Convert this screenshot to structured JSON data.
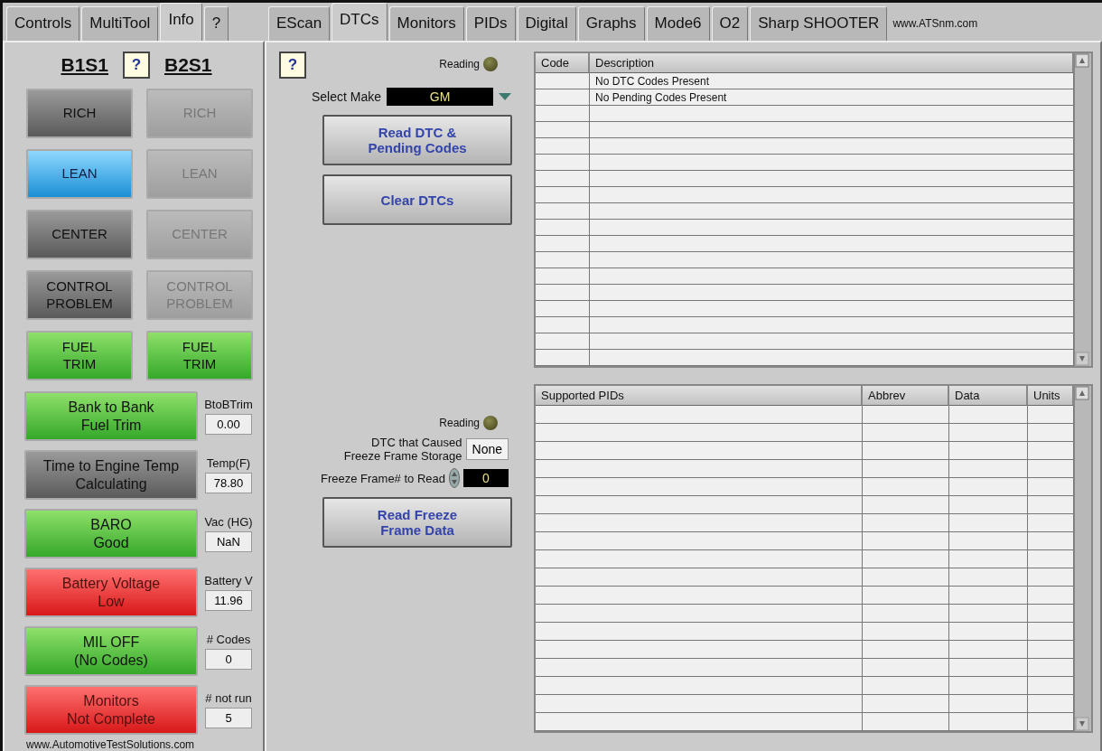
{
  "left_tabs": [
    {
      "label": "Controls",
      "selected": false
    },
    {
      "label": "MultiTool",
      "selected": false
    },
    {
      "label": "Info",
      "selected": true
    },
    {
      "label": "?",
      "selected": false
    }
  ],
  "right_tabs": [
    {
      "label": "EScan",
      "selected": false
    },
    {
      "label": "DTCs",
      "selected": true
    },
    {
      "label": "Monitors",
      "selected": false
    },
    {
      "label": "PIDs",
      "selected": false
    },
    {
      "label": "Digital",
      "selected": false
    },
    {
      "label": "Graphs",
      "selected": false
    },
    {
      "label": "Mode6",
      "selected": false
    },
    {
      "label": "O2",
      "selected": false
    },
    {
      "label": "Sharp SHOOTER",
      "selected": false
    }
  ],
  "site_link": "www.ATSnm.com",
  "bank_headers": [
    "B1S1",
    "B2S1"
  ],
  "help_button": "?",
  "o2_rows": [
    [
      {
        "label": "RICH",
        "kind": "dark"
      },
      {
        "label": "RICH",
        "kind": "dim"
      }
    ],
    [
      {
        "label": "LEAN",
        "kind": "blue"
      },
      {
        "label": "LEAN",
        "kind": "dim"
      }
    ],
    [
      {
        "label": "CENTER",
        "kind": "dark"
      },
      {
        "label": "CENTER",
        "kind": "dim"
      }
    ],
    [
      {
        "label": "CONTROL\nPROBLEM",
        "kind": "dark"
      },
      {
        "label": "CONTROL\nPROBLEM",
        "kind": "dim"
      }
    ],
    [
      {
        "label": "FUEL\nTRIM",
        "kind": "green"
      },
      {
        "label": "FUEL\nTRIM",
        "kind": "green"
      }
    ]
  ],
  "status": [
    {
      "label": "Bank to Bank\nFuel Trim",
      "kind": "green",
      "reading_label": "BtoBTrim",
      "value": "0.00"
    },
    {
      "label": "Time to Engine Temp\nCalculating",
      "kind": "dark",
      "reading_label": "Temp(F)",
      "value": "78.80"
    },
    {
      "label": "BARO\nGood",
      "kind": "green",
      "reading_label": "Vac (HG)",
      "value": "NaN"
    },
    {
      "label": "Battery Voltage\nLow",
      "kind": "red",
      "reading_label": "Battery V",
      "value": "11.96"
    },
    {
      "label": "MIL OFF\n(No Codes)",
      "kind": "green",
      "reading_label": "# Codes",
      "value": "0"
    },
    {
      "label": "Monitors\nNot Complete",
      "kind": "red",
      "reading_label": "# not run",
      "value": "5"
    }
  ],
  "footer": "www.AutomotiveTestSolutions.com",
  "dtc": {
    "help": "?",
    "reading_label": "Reading",
    "reading_lit": false,
    "make_label": "Select Make",
    "make_value": "GM",
    "buttons": [
      "Read DTC &\nPending Codes",
      "Clear DTCs"
    ]
  },
  "freeze": {
    "reading_label": "Reading",
    "reading_lit": false,
    "cause_label": "DTC that Caused\nFreeze Frame Storage",
    "cause_value": "None",
    "frame_label": "Freeze Frame# to Read",
    "frame_value": "0",
    "button": "Read Freeze\nFrame Data"
  },
  "dtc_table": {
    "columns": [
      "Code",
      "Description"
    ],
    "rows": [
      {
        "description": "No DTC Codes Present"
      },
      {
        "description": "No Pending Codes Present"
      }
    ]
  },
  "pid_table": {
    "columns": [
      "Supported PIDs",
      "Abbrev",
      "Data",
      "Units"
    ]
  }
}
